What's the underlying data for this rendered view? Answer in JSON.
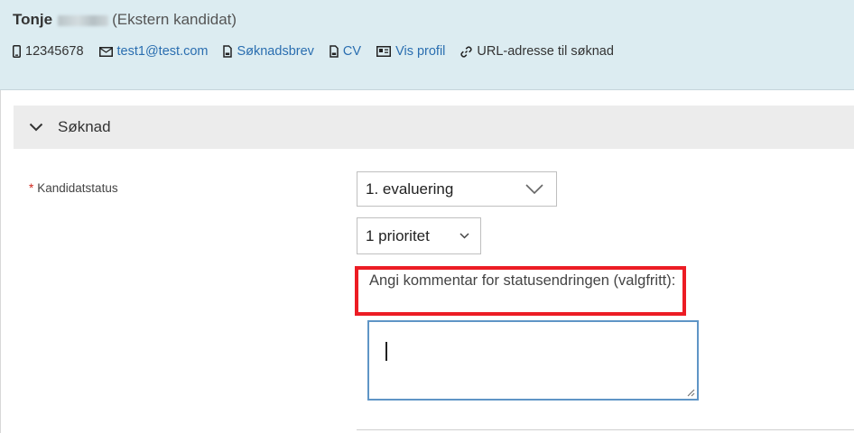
{
  "candidate": {
    "first_name": "Tonje",
    "type": "(Ekstern kandidat)"
  },
  "contacts": {
    "phone": "12345678",
    "email": "test1@test.com",
    "cover_letter": "Søknadsbrev",
    "cv": "CV",
    "profile": "Vis profil",
    "url": "URL-adresse til søknad"
  },
  "icons": [
    "phone-icon",
    "envelope-icon",
    "document-icon",
    "document-icon",
    "profile-card-icon",
    "link-icon",
    "chevron-down-icon"
  ],
  "section": {
    "title": "Søknad"
  },
  "form": {
    "required_marker": "*",
    "status_label": "Kandidatstatus",
    "status_value": "1. evaluering",
    "priority_value": "1 prioritet",
    "comment_label": "Angi kommentar for statusendringen (valgfritt):",
    "comment_value": ""
  },
  "colors": {
    "header_bg": "#dcecf1",
    "link": "#2a6eb0",
    "required": "#d0271d",
    "highlight": "#ec1c24",
    "focus_border": "#5f95c6"
  }
}
